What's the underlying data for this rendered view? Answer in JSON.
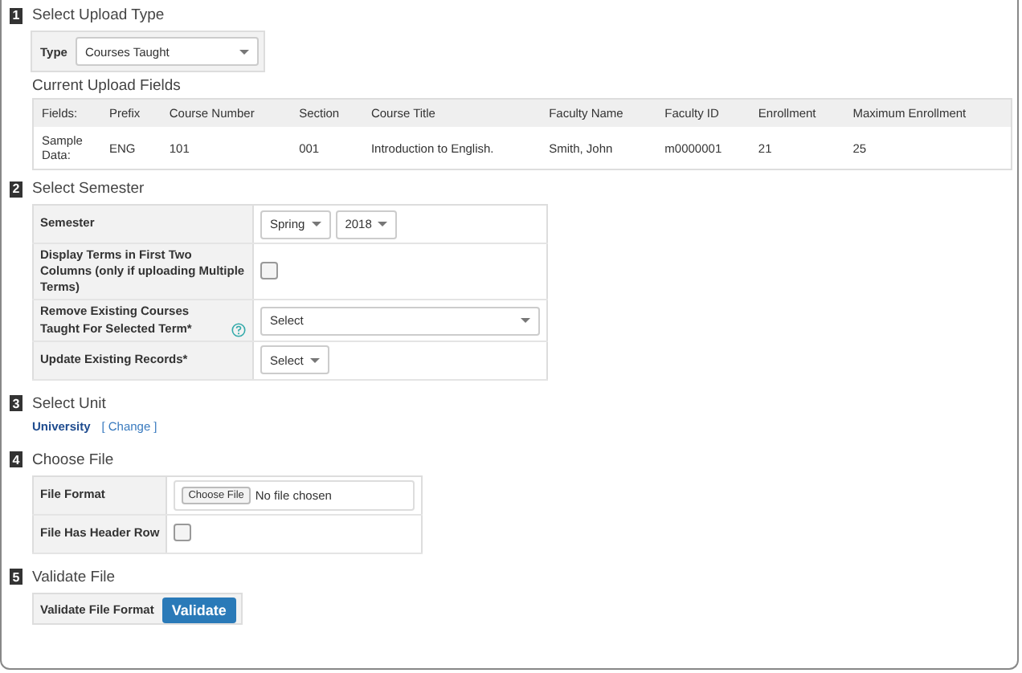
{
  "sections": [
    {
      "kind": "upload_type",
      "number": "1",
      "title": "Select Upload Type",
      "type_label": "Type",
      "type_value": "Courses Taught",
      "fields_heading": "Current Upload Fields",
      "columns": [
        "Fields:",
        "Prefix",
        "Course Number",
        "Section",
        "Course Title",
        "Faculty Name",
        "Faculty ID",
        "Enrollment",
        "Maximum Enrollment"
      ],
      "row": [
        "Sample Data:",
        "ENG",
        "101",
        "001",
        "Introduction to English.",
        "Smith, John",
        "m0000001",
        "21",
        "25"
      ]
    },
    {
      "kind": "semester",
      "number": "2",
      "title": "Select Semester",
      "rows": [
        {
          "kind": "selects",
          "label": "Semester",
          "selects": [
            "Spring",
            "2018"
          ]
        },
        {
          "kind": "checkbox",
          "label": "Display Terms in First Two Columns (only if uploading Multiple Terms)",
          "checked": false
        },
        {
          "kind": "wide_select",
          "label": "Remove Existing Courses Taught For Selected Term*",
          "help": true,
          "value": "Select"
        },
        {
          "kind": "selects",
          "label": "Update Existing Records*",
          "selects": [
            "Select"
          ]
        }
      ]
    },
    {
      "kind": "unit",
      "number": "3",
      "title": "Select Unit",
      "unit": "University",
      "change_open": "[",
      "change": "Change",
      "change_close": "]"
    },
    {
      "kind": "file",
      "number": "4",
      "title": "Choose File",
      "rows": [
        {
          "kind": "file",
          "label": "File Format",
          "button": "Choose File",
          "status": "No file chosen"
        },
        {
          "kind": "checkbox",
          "label": "File Has Header Row",
          "checked": false
        }
      ]
    },
    {
      "kind": "validate",
      "number": "5",
      "title": "Validate File",
      "label": "Validate File Format",
      "button": "Validate"
    }
  ]
}
